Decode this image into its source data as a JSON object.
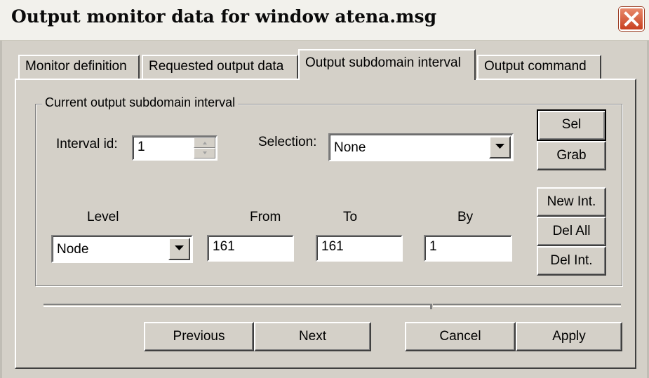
{
  "window": {
    "title": "Output monitor data for window atena.msg"
  },
  "tabs": [
    {
      "label": "Monitor definition",
      "active": false
    },
    {
      "label": "Requested output data",
      "active": false
    },
    {
      "label": "Output subdomain interval",
      "active": true
    },
    {
      "label": "Output command",
      "active": false
    }
  ],
  "group": {
    "legend": "Current output subdomain interval",
    "interval_id_label": "Interval id:",
    "interval_id_value": "1",
    "selection_label": "Selection:",
    "selection_value": "None",
    "columns": {
      "level": "Level",
      "from": "From",
      "to": "To",
      "by": "By"
    },
    "level_value": "Node",
    "from_value": "161",
    "to_value": "161",
    "by_value": "1"
  },
  "side_buttons": {
    "sel": "Sel",
    "grab": "Grab",
    "new_int": "New Int.",
    "del_all": "Del All",
    "del_int": "Del Int."
  },
  "footer": {
    "previous": "Previous",
    "next": "Next",
    "cancel": "Cancel",
    "apply": "Apply"
  },
  "icons": {
    "close": "close-icon",
    "dropdown": "chevron-down-icon",
    "spinner": "spinner-arrows-icon"
  },
  "colors": {
    "face": "#d4d0c8",
    "close_button": "#d34a2a",
    "title_bg": "#f2f1ec"
  }
}
